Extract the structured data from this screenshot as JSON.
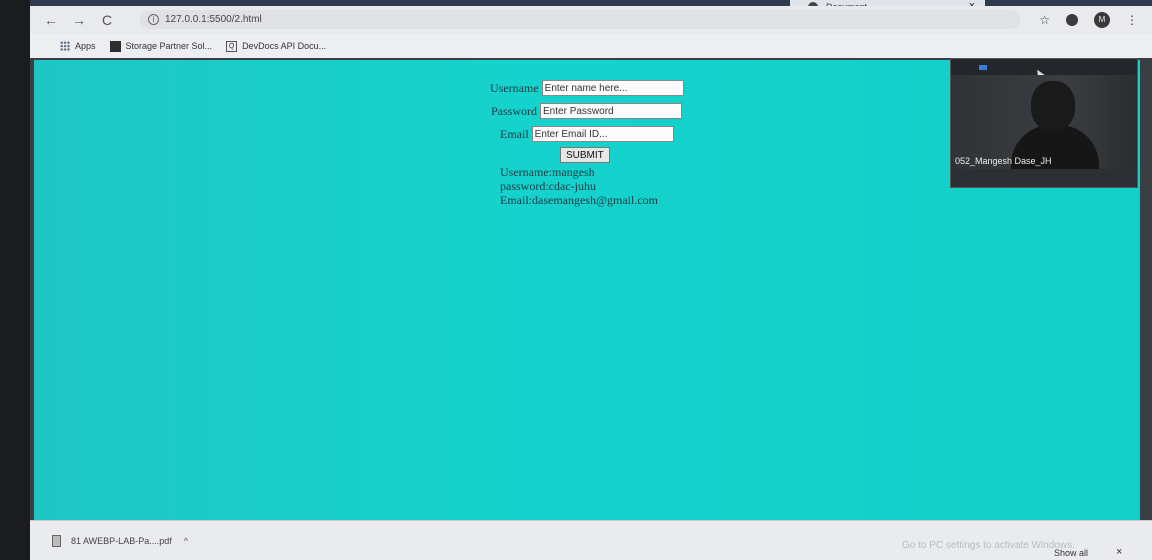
{
  "browser": {
    "tab_title": "Document",
    "tab_close": "×",
    "address": "127.0.0.1:5500/2.html",
    "nav": {
      "back": "←",
      "forward": "→",
      "reload": "C"
    },
    "star": "☆",
    "profile_initial": "M",
    "menu": "⋮",
    "bookmarks": [
      {
        "label": "Apps",
        "icon": "apps-icon"
      },
      {
        "label": "Storage Partner Sol...",
        "icon": "bookmark-square-icon"
      },
      {
        "label": "DevDocs API Docu...",
        "icon": "devdocs-icon"
      }
    ]
  },
  "form": {
    "username_label": "Username",
    "username_placeholder": "Enter name here...",
    "password_label": "Password",
    "password_placeholder": "Enter Password",
    "email_label": "Email",
    "email_placeholder": "Enter Email ID...",
    "submit_label": "SUBMIT"
  },
  "output": {
    "username": "Username:mangesh",
    "password": "password:cdac-juhu",
    "email": "Email:dasemangesh@gmail.com"
  },
  "video": {
    "participant_name": "052_Mangesh Dase_JH"
  },
  "downloads": {
    "file": "81 AWEBP-LAB-Pa....pdf",
    "chevron": "^",
    "show_all": "Show all",
    "close": "×"
  },
  "watermark": "Go to PC settings to activate Windows.",
  "colors": {
    "page_bg": "#15d3cc",
    "input_bg": "#fbfbfb"
  }
}
